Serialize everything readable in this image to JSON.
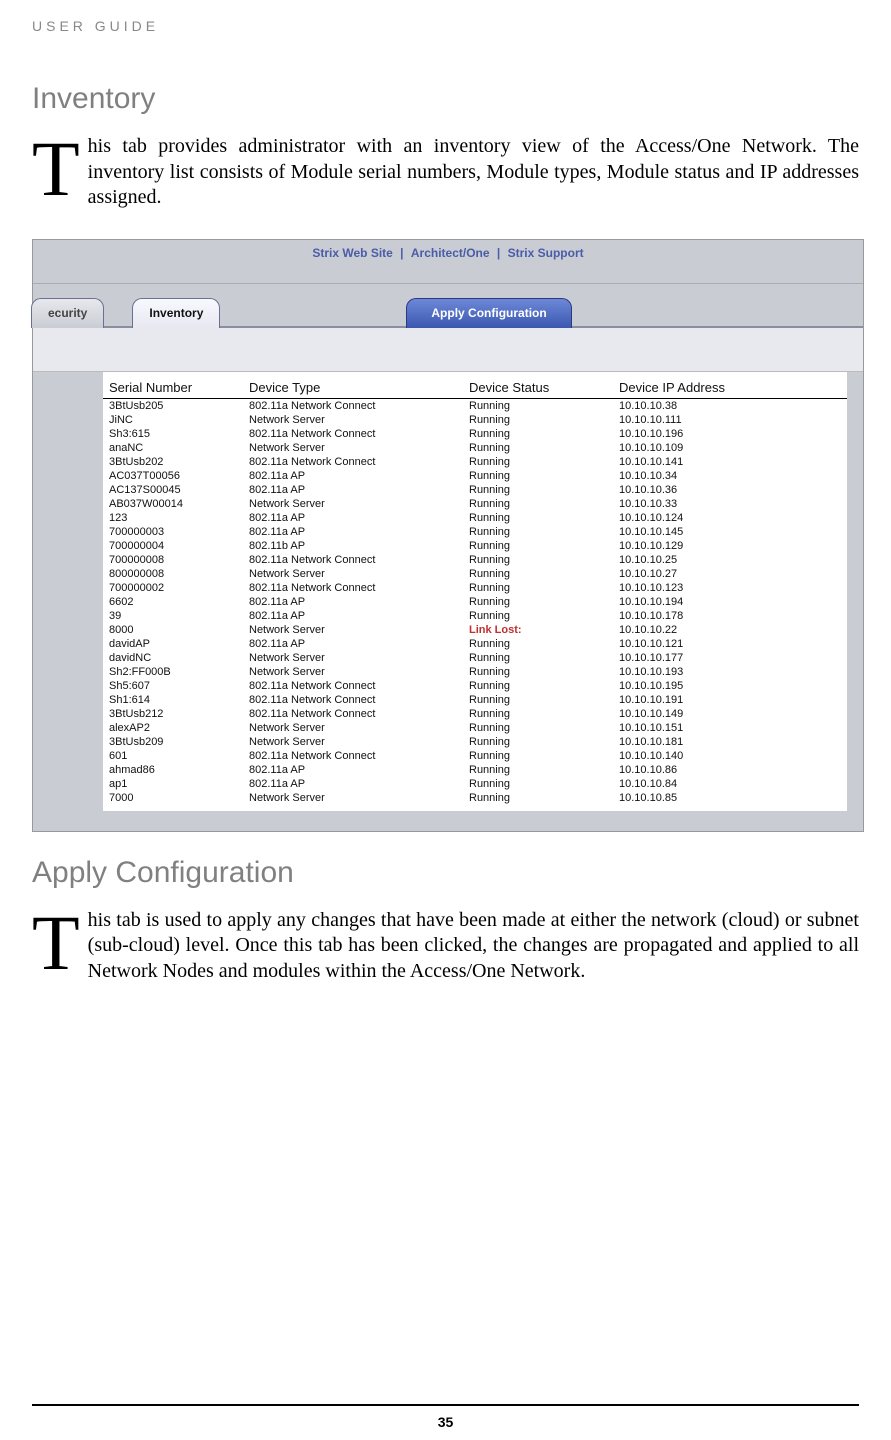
{
  "header": "USER GUIDE",
  "section1": {
    "title": "Inventory",
    "dropcap": "T",
    "text": "his tab provides administrator with an inventory view of the Access/One Network. The inventory list consists of Module serial numbers, Module types, Module status and IP addresses assigned."
  },
  "screenshot": {
    "toplinks": [
      "Strix Web Site",
      "|",
      "Architect/One",
      "|",
      "Strix Support"
    ],
    "tabs": {
      "left": "ecurity",
      "active": "Inventory",
      "blue": "Apply Configuration"
    },
    "columns": [
      "Serial Number",
      "Device Type",
      "Device Status",
      "Device IP Address"
    ],
    "rows": [
      {
        "sn": "3BtUsb205",
        "type": "802.11a Network Connect",
        "status": "Running",
        "ip": "10.10.10.38"
      },
      {
        "sn": "JiNC",
        "type": "Network Server",
        "status": "Running",
        "ip": "10.10.10.111"
      },
      {
        "sn": "Sh3:615",
        "type": "802.11a Network Connect",
        "status": "Running",
        "ip": "10.10.10.196"
      },
      {
        "sn": "anaNC",
        "type": "Network Server",
        "status": "Running",
        "ip": "10.10.10.109"
      },
      {
        "sn": "3BtUsb202",
        "type": "802.11a Network Connect",
        "status": "Running",
        "ip": "10.10.10.141"
      },
      {
        "sn": "AC037T00056",
        "type": "802.11a AP",
        "status": "Running",
        "ip": "10.10.10.34"
      },
      {
        "sn": "AC137S00045",
        "type": "802.11a AP",
        "status": "Running",
        "ip": "10.10.10.36"
      },
      {
        "sn": "AB037W00014",
        "type": "Network Server",
        "status": "Running",
        "ip": "10.10.10.33"
      },
      {
        "sn": "123",
        "type": "802.11a AP",
        "status": "Running",
        "ip": "10.10.10.124"
      },
      {
        "sn": "700000003",
        "type": "802.11a AP",
        "status": "Running",
        "ip": "10.10.10.145"
      },
      {
        "sn": "700000004",
        "type": "802.11b AP",
        "status": "Running",
        "ip": "10.10.10.129"
      },
      {
        "sn": "700000008",
        "type": "802.11a Network Connect",
        "status": "Running",
        "ip": "10.10.10.25"
      },
      {
        "sn": "800000008",
        "type": "Network Server",
        "status": "Running",
        "ip": "10.10.10.27"
      },
      {
        "sn": "700000002",
        "type": "802.11a Network Connect",
        "status": "Running",
        "ip": "10.10.10.123"
      },
      {
        "sn": "6602",
        "type": "802.11a AP",
        "status": "Running",
        "ip": "10.10.10.194"
      },
      {
        "sn": "39",
        "type": "802.11a AP",
        "status": "Running",
        "ip": "10.10.10.178"
      },
      {
        "sn": "8000",
        "type": "Network Server",
        "status": "Link Lost:",
        "ip": "10.10.10.22",
        "linklost": true
      },
      {
        "sn": "davidAP",
        "type": "802.11a AP",
        "status": "Running",
        "ip": "10.10.10.121"
      },
      {
        "sn": "davidNC",
        "type": "Network Server",
        "status": "Running",
        "ip": "10.10.10.177"
      },
      {
        "sn": "Sh2:FF000B",
        "type": "Network Server",
        "status": "Running",
        "ip": "10.10.10.193"
      },
      {
        "sn": "Sh5:607",
        "type": "802.11a Network Connect",
        "status": "Running",
        "ip": "10.10.10.195"
      },
      {
        "sn": "Sh1:614",
        "type": "802.11a Network Connect",
        "status": "Running",
        "ip": "10.10.10.191"
      },
      {
        "sn": "3BtUsb212",
        "type": "802.11a Network Connect",
        "status": "Running",
        "ip": "10.10.10.149"
      },
      {
        "sn": "alexAP2",
        "type": "Network Server",
        "status": "Running",
        "ip": "10.10.10.151"
      },
      {
        "sn": "3BtUsb209",
        "type": "Network Server",
        "status": "Running",
        "ip": "10.10.10.181"
      },
      {
        "sn": "601",
        "type": "802.11a Network Connect",
        "status": "Running",
        "ip": "10.10.10.140"
      },
      {
        "sn": "ahmad86",
        "type": "802.11a AP",
        "status": "Running",
        "ip": "10.10.10.86"
      },
      {
        "sn": "ap1",
        "type": "802.11a AP",
        "status": "Running",
        "ip": "10.10.10.84"
      },
      {
        "sn": "7000",
        "type": "Network Server",
        "status": "Running",
        "ip": "10.10.10.85"
      }
    ]
  },
  "section2": {
    "title": "Apply Configuration",
    "dropcap": "T",
    "text": "his tab is used to apply any changes that have been made at either the network (cloud) or subnet (sub-cloud) level. Once this tab has been clicked, the changes are propagated and applied to all Network Nodes and modules within the Access/One Network."
  },
  "page": "35"
}
